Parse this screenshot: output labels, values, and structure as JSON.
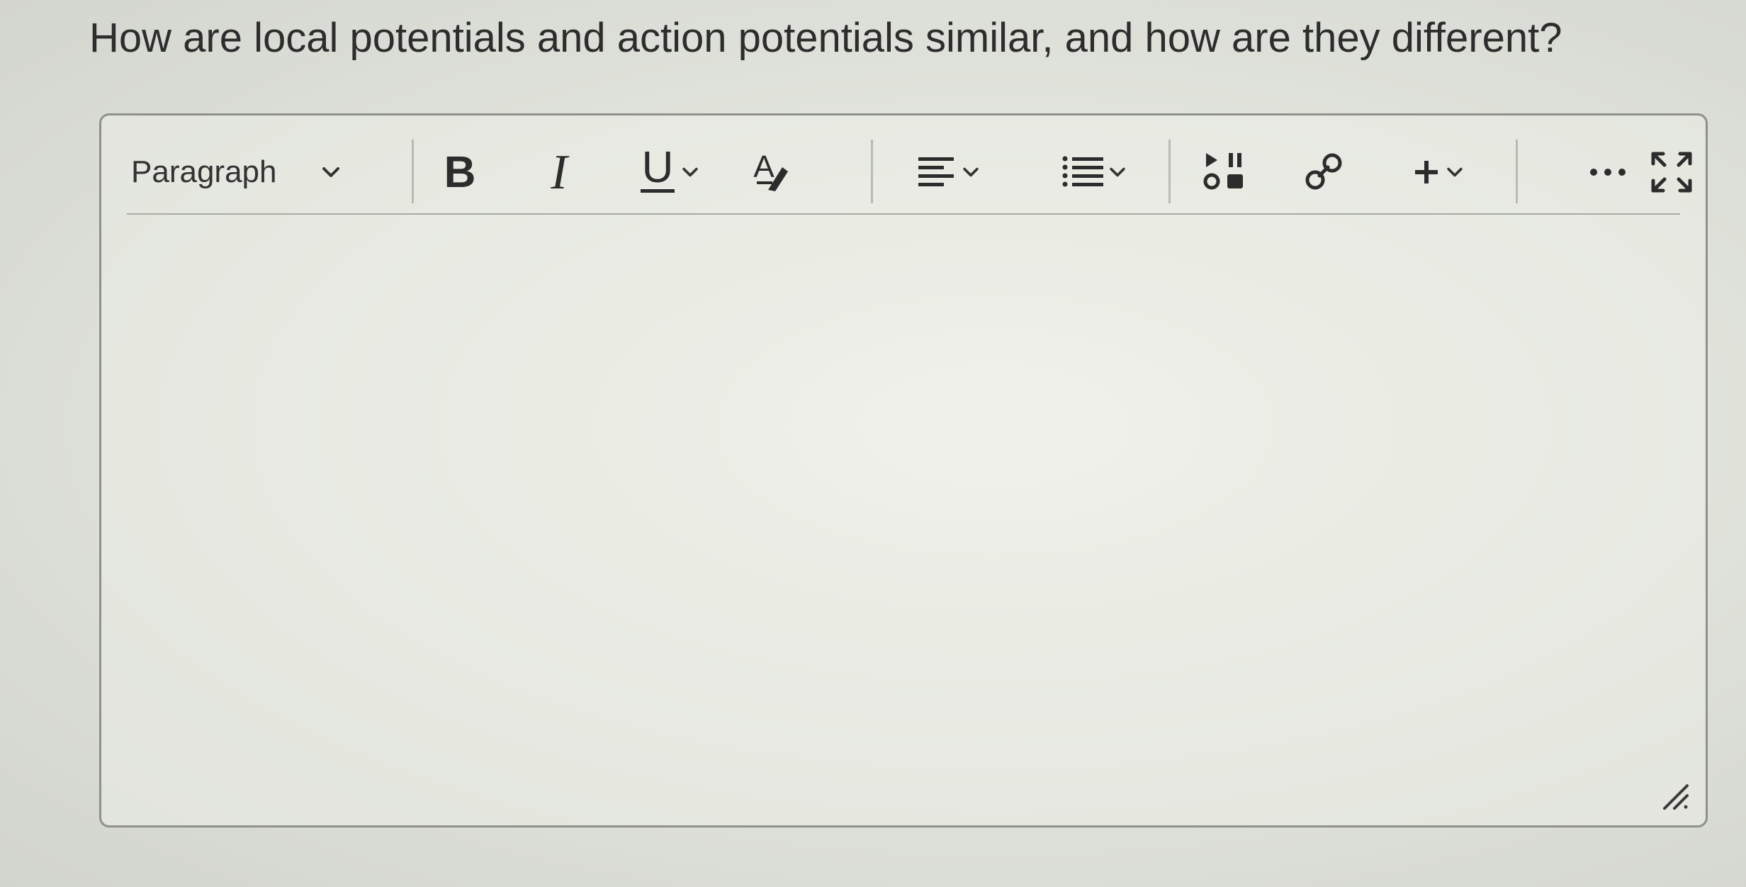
{
  "question": {
    "text": "How are local potentials and action potentials similar, and how are they different?"
  },
  "editor": {
    "toolbar": {
      "block_format": "Paragraph",
      "buttons": [
        {
          "name": "bold-button",
          "icon": "bold-icon",
          "glyph": "B"
        },
        {
          "name": "italic-button",
          "icon": "italic-icon",
          "glyph": "I"
        },
        {
          "name": "underline-button",
          "icon": "underline-icon",
          "glyph": "U"
        },
        {
          "name": "text-color-button",
          "icon": "text-color-icon",
          "glyph": "A"
        },
        {
          "name": "align-button",
          "icon": "align-left-icon"
        },
        {
          "name": "list-button",
          "icon": "list-icon"
        },
        {
          "name": "media-button",
          "icon": "media-icon"
        },
        {
          "name": "link-button",
          "icon": "link-icon"
        },
        {
          "name": "insert-button",
          "icon": "plus-icon",
          "glyph": "+"
        },
        {
          "name": "more-button",
          "icon": "more-icon"
        },
        {
          "name": "fullscreen-button",
          "icon": "fullscreen-icon"
        }
      ]
    },
    "content": ""
  },
  "colors": {
    "text": "#2d2d2d",
    "border": "#8e918b",
    "divider": "#b8bbb4"
  }
}
